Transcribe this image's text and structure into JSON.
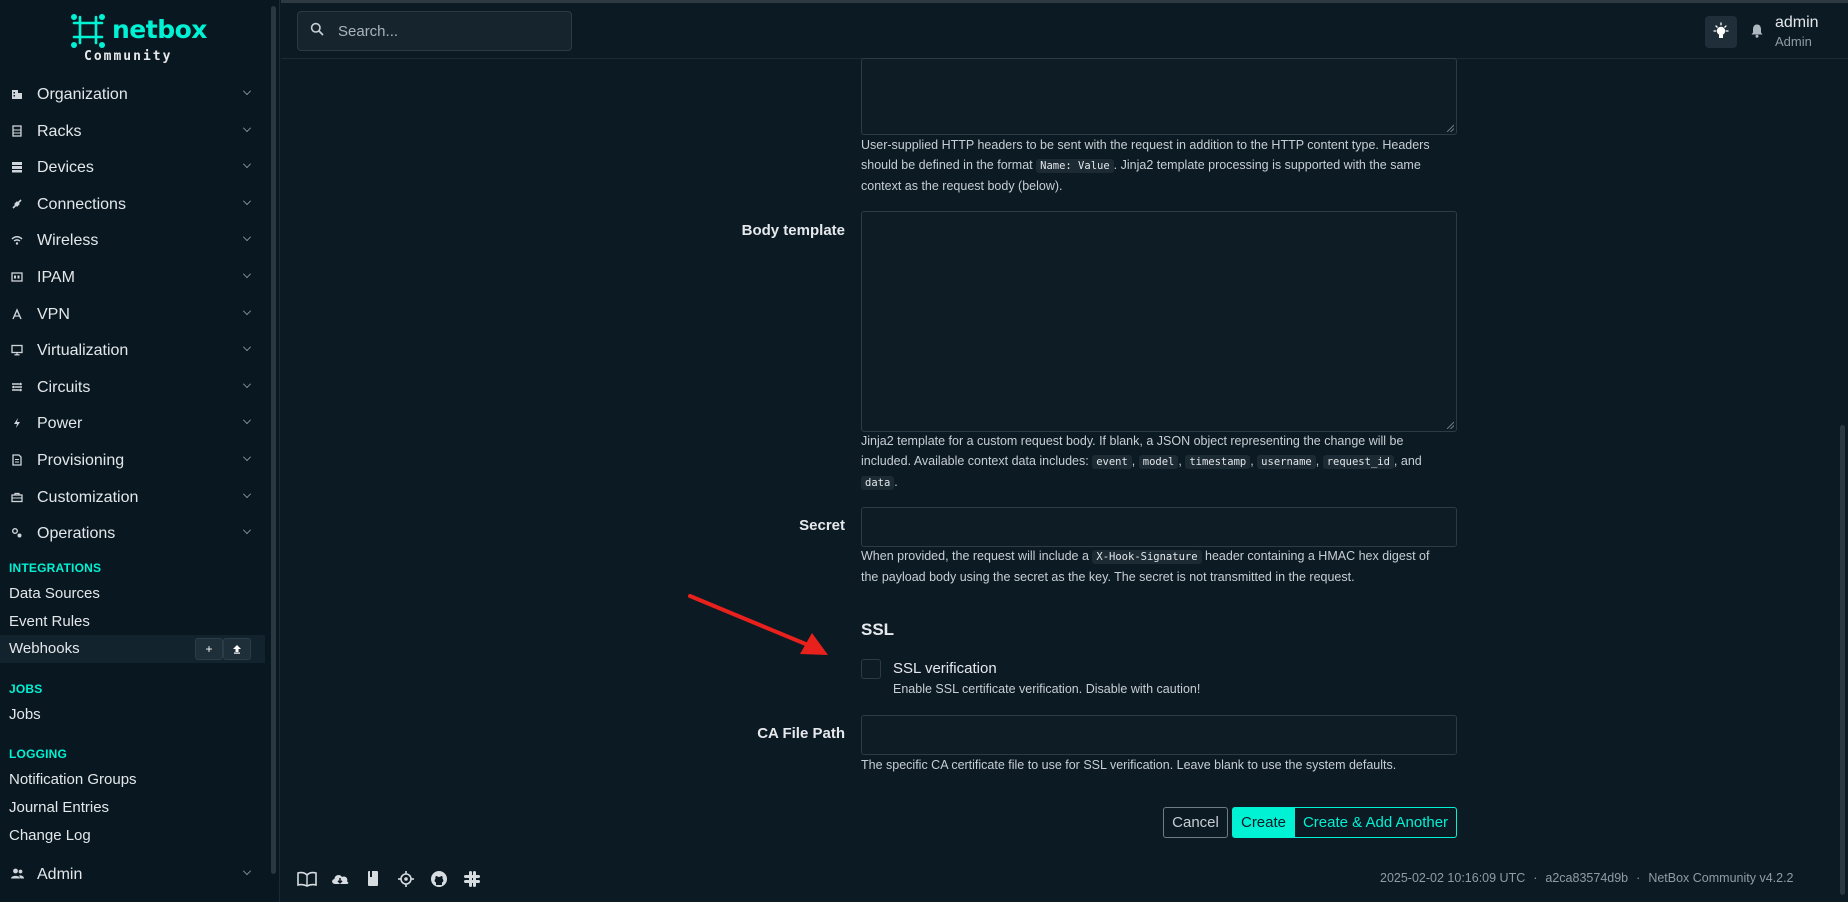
{
  "brand": {
    "name": "netbox",
    "edition": "Community"
  },
  "sidebar": {
    "menus": [
      {
        "label": "Organization",
        "icon": "building-icon"
      },
      {
        "label": "Racks",
        "icon": "rack-icon"
      },
      {
        "label": "Devices",
        "icon": "server-icon"
      },
      {
        "label": "Connections",
        "icon": "plug-icon"
      },
      {
        "label": "Wireless",
        "icon": "wifi-icon"
      },
      {
        "label": "IPAM",
        "icon": "counter-icon"
      },
      {
        "label": "VPN",
        "icon": "tunnel-icon"
      },
      {
        "label": "Virtualization",
        "icon": "monitor-icon"
      },
      {
        "label": "Circuits",
        "icon": "circuits-icon"
      },
      {
        "label": "Power",
        "icon": "flash-icon"
      },
      {
        "label": "Provisioning",
        "icon": "file-document-icon"
      },
      {
        "label": "Customization",
        "icon": "toolbox-icon"
      },
      {
        "label": "Operations",
        "icon": "cogs-icon"
      }
    ],
    "integrations_title": "INTEGRATIONS",
    "integrations": [
      "Data Sources",
      "Event Rules",
      "Webhooks"
    ],
    "jobs_title": "JOBS",
    "jobs": [
      "Jobs"
    ],
    "logging_title": "LOGGING",
    "logging": [
      "Notification Groups",
      "Journal Entries",
      "Change Log"
    ],
    "admin": "Admin"
  },
  "header": {
    "search_placeholder": "Search...",
    "user_name": "admin",
    "user_role": "Admin"
  },
  "form": {
    "headers_help_1": "User-supplied HTTP headers to be sent with the request in addition to the HTTP content type. Headers",
    "headers_help_2a": "should be defined in the format ",
    "headers_help_code": "Name: Value",
    "headers_help_2b": ". Jinja2 template processing is supported with the same",
    "headers_help_3": "context as the request body (below).",
    "body_template_label": "Body template",
    "body_help_1": "Jinja2 template for a custom request body. If blank, a JSON object representing the change will be",
    "body_help_2a": "included. Available context data includes: ",
    "body_codes": [
      "event",
      "model",
      "timestamp",
      "username",
      "request_id",
      "data"
    ],
    "body_help_sep": ", ",
    "body_help_and": ", and",
    "body_help_end": ".",
    "secret_label": "Secret",
    "secret_help_1a": "When provided, the request will include a ",
    "secret_help_code": "X-Hook-Signature",
    "secret_help_1b": " header containing a HMAC hex digest of",
    "secret_help_2": "the payload body using the secret as the key. The secret is not transmitted in the request.",
    "ssl_heading": "SSL",
    "ssl_label": "SSL verification",
    "ssl_help": "Enable SSL certificate verification. Disable with caution!",
    "ca_label": "CA File Path",
    "ca_help": "The specific CA certificate file to use for SSL verification. Leave blank to use the system defaults.",
    "cancel": "Cancel",
    "create": "Create",
    "create_add": "Create & Add Another"
  },
  "footer": {
    "timestamp": "2025-02-02 10:16:09 UTC",
    "commit": "a2ca83574d9b",
    "version": "NetBox Community v4.2.2",
    "separator": "·"
  },
  "colors": {
    "accent": "#00f2d4",
    "annotation_arrow": "#e8211d"
  }
}
